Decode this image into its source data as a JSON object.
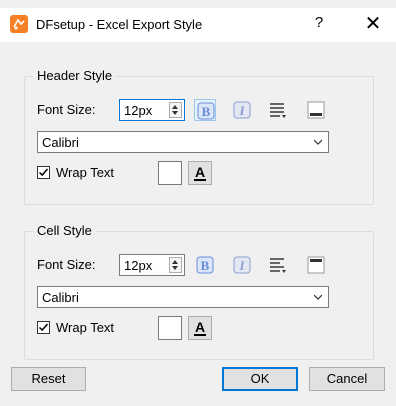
{
  "window": {
    "title": "DFsetup - Excel Export Style",
    "help": "?",
    "close": "✕"
  },
  "header_style": {
    "title": "Header Style",
    "font_size_label": "Font Size:",
    "font_size_value": "12px",
    "font_name": "Calibri",
    "wrap_text_label": "Wrap Text",
    "wrap_text_checked": true,
    "font_color_glyph": "A"
  },
  "cell_style": {
    "title": "Cell Style",
    "font_size_label": "Font Size:",
    "font_size_value": "12px",
    "font_name": "Calibri",
    "wrap_text_label": "Wrap Text",
    "wrap_text_checked": true,
    "font_color_glyph": "A"
  },
  "buttons": {
    "reset": "Reset",
    "ok": "OK",
    "cancel": "Cancel"
  },
  "colors": {
    "accent": "#0078d7",
    "bold_icon": "#6a8fd8",
    "italic_icon": "#8a9fd0",
    "app_icon": "#f58025"
  }
}
